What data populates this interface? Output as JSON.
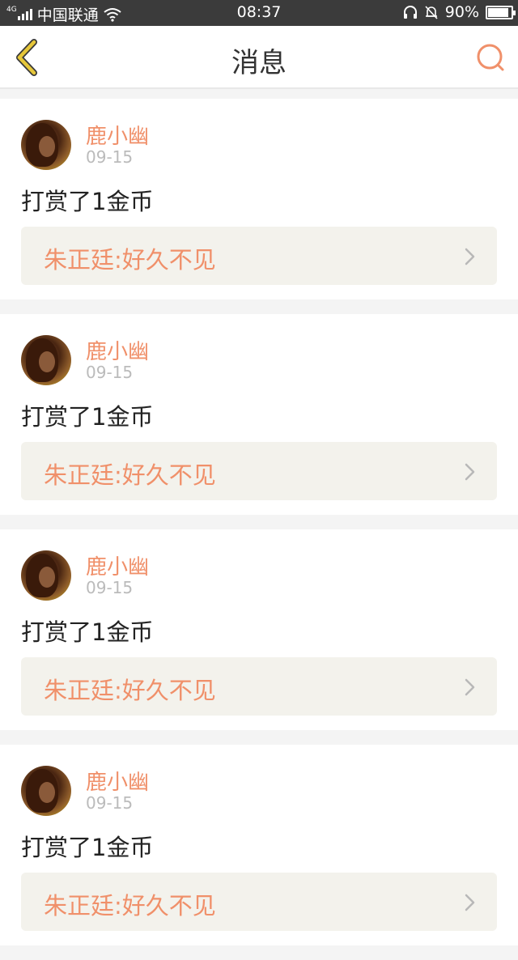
{
  "status_bar": {
    "network_tag": "4G",
    "carrier": "中国联通",
    "time": "08:37",
    "battery_percent_label": "90%",
    "battery_level": 0.9
  },
  "nav": {
    "title": "消息"
  },
  "colors": {
    "accent": "#f0906a",
    "back_arrow": "#e6c73a"
  },
  "messages": [
    {
      "user": "鹿小幽",
      "date": "09-15",
      "text": "打赏了1金币",
      "quote": "朱正廷:好久不见"
    },
    {
      "user": "鹿小幽",
      "date": "09-15",
      "text": "打赏了1金币",
      "quote": "朱正廷:好久不见"
    },
    {
      "user": "鹿小幽",
      "date": "09-15",
      "text": "打赏了1金币",
      "quote": "朱正廷:好久不见"
    },
    {
      "user": "鹿小幽",
      "date": "09-15",
      "text": "打赏了1金币",
      "quote": "朱正廷:好久不见"
    }
  ]
}
